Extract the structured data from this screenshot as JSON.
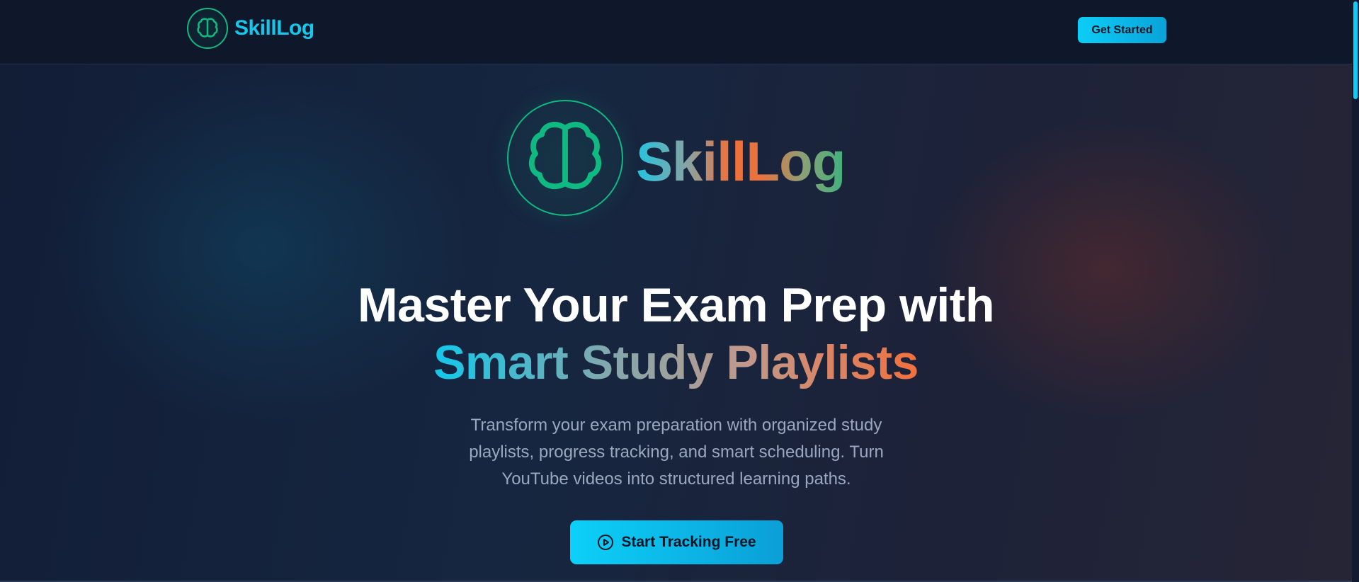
{
  "navbar": {
    "brand": "SkillLog",
    "cta_label": "Get Started",
    "logo_icon": "brain-icon"
  },
  "hero": {
    "logo_icon": "brain-icon",
    "brand": "SkillLog",
    "headline_line1": "Master Your Exam Prep with",
    "headline_line2": "Smart Study Playlists",
    "subtitle": "Transform your exam preparation with organized study playlists, progress tracking, and smart scheduling. Turn YouTube videos into structured learning paths.",
    "cta_label": "Start Tracking Free",
    "cta_icon": "play-circle-icon"
  },
  "colors": {
    "accent_cyan": "#0ccdf6",
    "logo_green": "#10b981",
    "accent_orange": "#f0703a",
    "background": "#14203a"
  }
}
